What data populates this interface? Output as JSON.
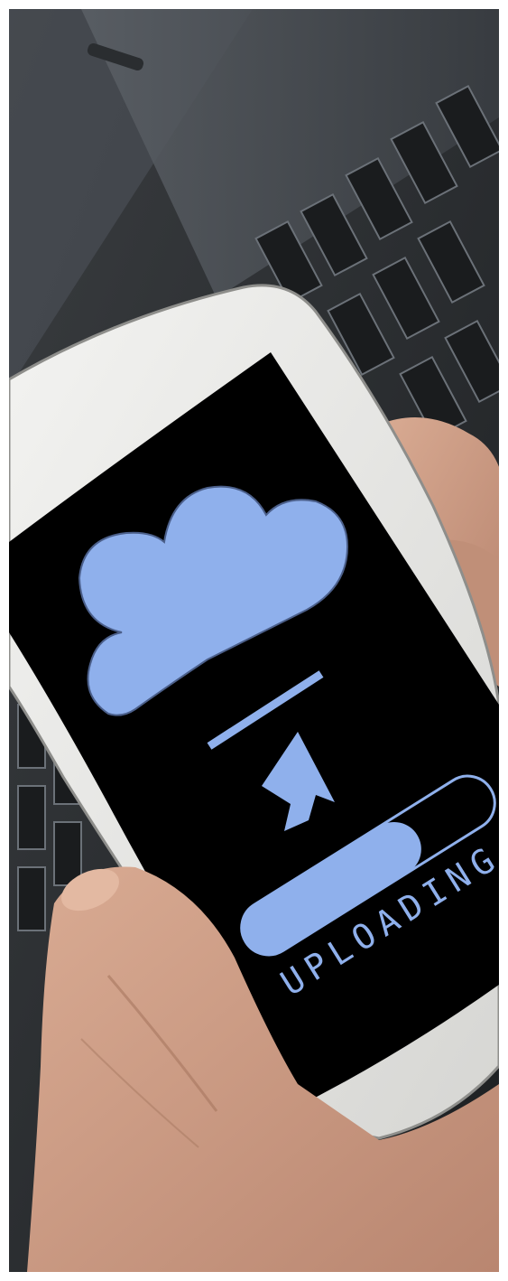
{
  "photo": {
    "background": "server-rack-photo",
    "subject": "smartphone-held-in-hand"
  },
  "phone_screen": {
    "icon": "cloud-upload-icon",
    "progress_fraction": 0.7,
    "status_text": "UPLOADING"
  },
  "colors": {
    "accent": "#8fb0ec",
    "screen": "#000000",
    "phone_body": "#e6e6e4",
    "skin": "#c99a82"
  }
}
